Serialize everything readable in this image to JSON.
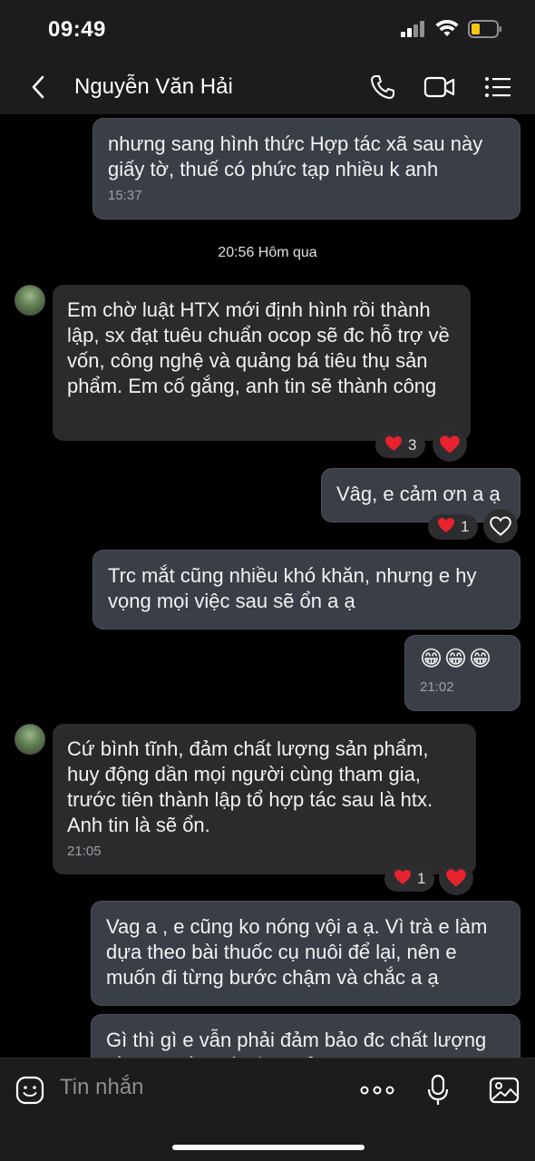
{
  "status": {
    "time": "09:49"
  },
  "header": {
    "contact_name": "Nguyễn Văn Hải"
  },
  "messages": [
    {
      "text": "nhưng sang hình thức Hợp tác xã sau này giấy tờ, thuế có phức tạp nhiều k anh",
      "time": "15:37"
    },
    {
      "text": "Em chờ luật HTX mới định hình rồi thành lập, sx đạt tuêu chuẩn ocop sẽ đc hỗ trợ về vốn, công nghệ và quảng bá tiêu thụ sản phẩm. Em cố gắng, anh tin sẽ thành công",
      "reaction_count": "3"
    },
    {
      "text": "Vâg, e cảm ơn a ạ",
      "reaction_count": "1"
    },
    {
      "text": "Trc mắt cũng nhiều khó khăn, nhưng e hy vọng mọi việc sau sẽ ổn a ạ"
    },
    {
      "text": "😁😁😁",
      "time": "21:02"
    },
    {
      "text": "Cứ bình tĩnh, đảm chất lượng sản phẩm, huy động dần mọi người cùng tham gia, trước tiên thành lập tổ hợp tác sau là htx. Anh tin là sẽ ổn.",
      "time": "21:05",
      "reaction_count": "1"
    },
    {
      "text": "Vag a , e cũng ko nóng vội a ạ. Vì trà e làm dựa theo bài thuốc cụ nuôi để lại, nên e muốn đi từng bước chậm và chắc a ạ"
    },
    {
      "text": "Gì thì gì e vẫn phải đảm bảo đc chất lượng đầu tiên rồi mới tính mở rộng sau"
    }
  ],
  "date_separator": "20:56 Hôm qua",
  "input": {
    "placeholder": "Tin nhắn"
  },
  "colors": {
    "background": "#000000",
    "outgoing_bubble": "#3a3f47",
    "incoming_bubble": "#2b2b2d",
    "heart": "#e8222e"
  }
}
